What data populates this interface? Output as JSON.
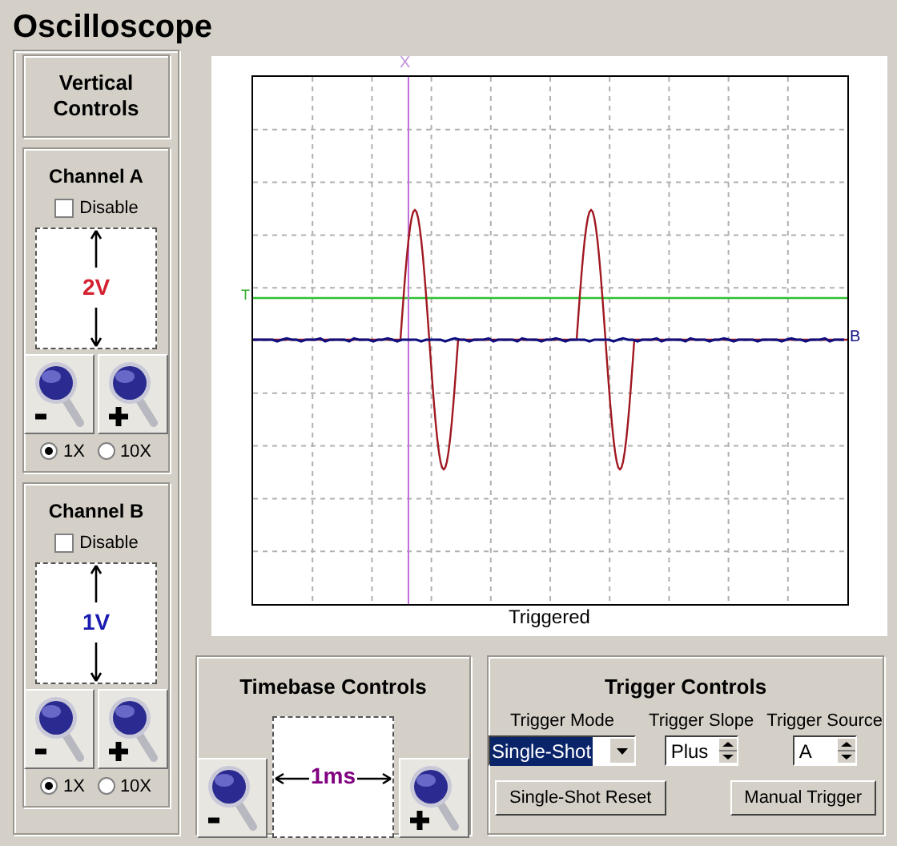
{
  "title": "Oscilloscope",
  "vertical": {
    "title": "Vertical Controls",
    "channels": [
      {
        "name": "Channel A",
        "disable_label": "Disable",
        "disabled": false,
        "scale": "2V",
        "color": "#d42030",
        "probes": [
          {
            "label": "1X",
            "selected": true
          },
          {
            "label": "10X",
            "selected": false
          }
        ]
      },
      {
        "name": "Channel B",
        "disable_label": "Disable",
        "disabled": false,
        "scale": "1V",
        "color": "#1a1ab0",
        "probes": [
          {
            "label": "1X",
            "selected": true
          },
          {
            "label": "10X",
            "selected": false
          }
        ]
      }
    ]
  },
  "display": {
    "cursor_marker": "X",
    "trigger_marker": "T",
    "channel_marker": "B",
    "status": "Triggered"
  },
  "timebase": {
    "title": "Timebase Controls",
    "scale": "1ms"
  },
  "trigger": {
    "title": "Trigger Controls",
    "mode": {
      "label": "Trigger Mode",
      "value": "Single-Shot"
    },
    "slope": {
      "label": "Trigger Slope",
      "value": "Plus"
    },
    "source": {
      "label": "Trigger Source",
      "value": "A"
    },
    "buttons": [
      "Single-Shot Reset",
      "Manual Trigger"
    ]
  }
}
